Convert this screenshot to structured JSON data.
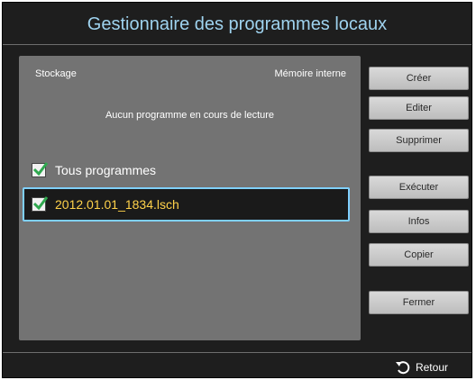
{
  "dialog": {
    "title": "Gestionnaire des programmes locaux"
  },
  "storage": {
    "label": "Stockage",
    "value": "Mémoire interne"
  },
  "status": "Aucun programme en cours de lecture",
  "list": {
    "all_label": "Tous programmes",
    "all_checked": true,
    "items": [
      {
        "label": "2012.01.01_1834.lsch",
        "checked": true
      }
    ]
  },
  "buttons": {
    "create": "Créer",
    "edit": "Editer",
    "delete": "Supprimer",
    "run": "Exécuter",
    "info": "Infos",
    "copy": "Copier",
    "close": "Fermer"
  },
  "footer": {
    "back_label": "Retour",
    "back_icon": "return-arrow-icon"
  },
  "colors": {
    "title": "#9fd3ef",
    "highlight_text": "#ffd24a",
    "focus_border": "#7fd0ff",
    "check": "#2fa84f"
  }
}
